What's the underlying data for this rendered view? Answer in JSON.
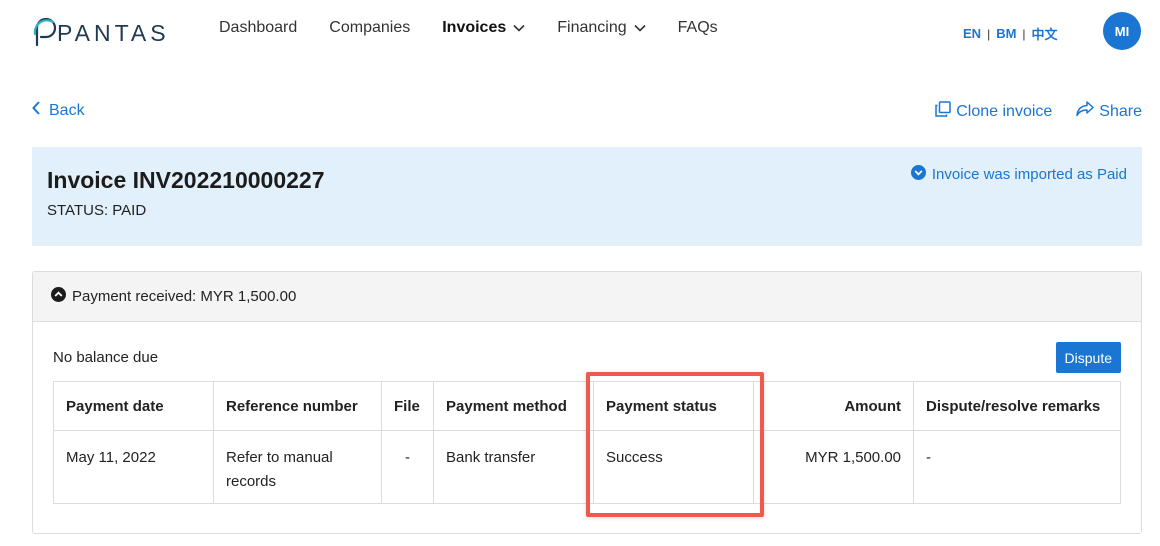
{
  "brand": {
    "logo_text": "PANTAS",
    "accent": "#1a76d2"
  },
  "nav": {
    "items": [
      {
        "label": "Dashboard",
        "active": false,
        "dropdown": false
      },
      {
        "label": "Companies",
        "active": false,
        "dropdown": false
      },
      {
        "label": "Invoices",
        "active": true,
        "dropdown": true
      },
      {
        "label": "Financing",
        "active": false,
        "dropdown": true
      },
      {
        "label": "FAQs",
        "active": false,
        "dropdown": false
      }
    ]
  },
  "language": {
    "options": [
      "EN",
      "BM",
      "中文"
    ],
    "separator": "|"
  },
  "user": {
    "initials": "MI"
  },
  "toolbar": {
    "back_label": "Back",
    "clone_label": "Clone invoice",
    "share_label": "Share"
  },
  "invoice": {
    "title": "Invoice INV202210000227",
    "status_text": "STATUS: PAID",
    "imported_note": "Invoice was imported as Paid"
  },
  "payment": {
    "header": "Payment received: MYR 1,500.00",
    "balance_text": "No balance due",
    "dispute_label": "Dispute",
    "columns": [
      "Payment date",
      "Reference number",
      "File",
      "Payment method",
      "Payment status",
      "Amount",
      "Dispute/resolve remarks"
    ],
    "rows": [
      [
        "May 11, 2022",
        "Refer to manual records",
        "-",
        "Bank transfer",
        "Success",
        "MYR 1,500.00",
        "-"
      ]
    ]
  },
  "icons": {
    "back": "chevron-left-icon",
    "clone": "copy-icon",
    "share": "share-icon",
    "imported": "chevron-down-circle-icon",
    "collapse": "chevron-up-circle-icon",
    "nav_dropdown": "chevron-down-icon"
  },
  "highlight_color": "#ef5a4b"
}
